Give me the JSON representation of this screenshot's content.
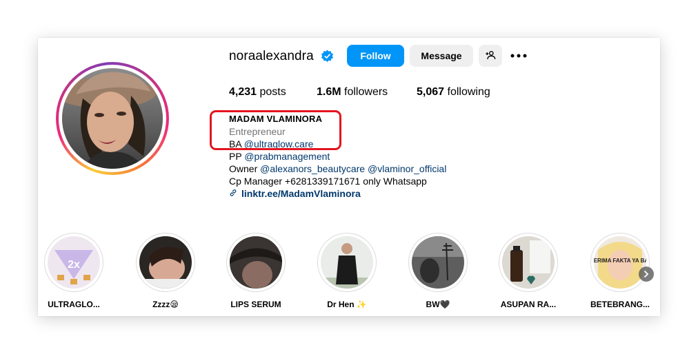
{
  "profile": {
    "username": "noraalexandra",
    "follow_label": "Follow",
    "message_label": "Message"
  },
  "stats": {
    "posts_count": "4,231",
    "posts_label": "posts",
    "followers_count": "1.6M",
    "followers_label": "followers",
    "following_count": "5,067",
    "following_label": "following"
  },
  "bio": {
    "name": "MADAM VLAMINORA",
    "category": "Entrepreneur",
    "line1_prefix": "BA",
    "line1_link": "@ultraglow.care",
    "line2_prefix": "PP",
    "line2_link": "@prabmanagement",
    "line3_prefix": "Owner",
    "line3_link1": "@alexanors_beautycare",
    "line3_link2": "@vlaminor_official",
    "line4": "Cp Manager +6281339171671 only Whatsapp",
    "external_link": "linktr.ee/MadamVlaminora"
  },
  "highlights": [
    {
      "label": "ULTRAGLO...",
      "badge_text": "2x"
    },
    {
      "label": "Zzzz😪"
    },
    {
      "label": "LIPS SERUM"
    },
    {
      "label": "Dr Hen ✨"
    },
    {
      "label": "BW🖤"
    },
    {
      "label": "ASUPAN RA..."
    },
    {
      "label": "BETEBRANG...",
      "overlay_text": "GA NERIMA FAKTA YA BANG?"
    }
  ],
  "colors": {
    "accent": "#0095f6",
    "link": "#00376b",
    "annotation_box": "#e4141e",
    "muted": "#737373"
  },
  "icons": [
    "verified-badge-icon",
    "add-user-icon",
    "more-options-icon",
    "link-icon",
    "chevron-right-icon"
  ]
}
